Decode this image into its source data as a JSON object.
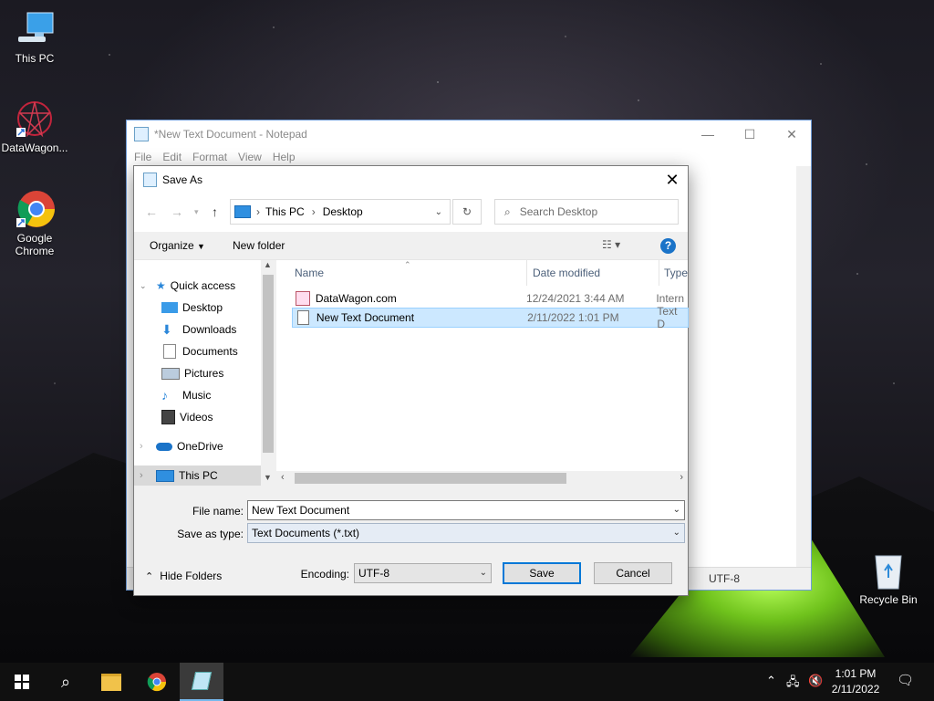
{
  "desktop": {
    "icons": [
      {
        "label": "This PC"
      },
      {
        "label": "DataWagon..."
      },
      {
        "label": "Google Chrome"
      },
      {
        "label": "Recycle Bin"
      }
    ]
  },
  "notepad": {
    "title": "*New Text Document - Notepad",
    "menu": [
      "File",
      "Edit",
      "Format",
      "View",
      "Help"
    ],
    "status_encoding": "UTF-8"
  },
  "dialog": {
    "title": "Save As",
    "address": {
      "segments": [
        "This PC",
        "Desktop"
      ]
    },
    "search_placeholder": "Search Desktop",
    "toolbar": {
      "organize": "Organize",
      "new_folder": "New folder"
    },
    "nav_items": [
      {
        "label": "Quick access",
        "icon": "star-icon"
      },
      {
        "label": "Desktop",
        "icon": "desktop-folder-icon",
        "pinned": true
      },
      {
        "label": "Downloads",
        "icon": "download-arrow-icon",
        "pinned": true
      },
      {
        "label": "Documents",
        "icon": "documents-icon",
        "pinned": true
      },
      {
        "label": "Pictures",
        "icon": "pictures-icon",
        "pinned": true
      },
      {
        "label": "Music",
        "icon": "music-note-icon"
      },
      {
        "label": "Videos",
        "icon": "film-icon"
      },
      {
        "label": "OneDrive",
        "icon": "cloud-icon"
      },
      {
        "label": "This PC",
        "icon": "monitor-icon"
      }
    ],
    "columns": [
      "Name",
      "Date modified",
      "Type"
    ],
    "files": [
      {
        "name": "DataWagon.com",
        "date": "12/24/2021 3:44 AM",
        "type": "Intern",
        "icon": "internet-shortcut-icon",
        "selected": false
      },
      {
        "name": "New Text Document",
        "date": "2/11/2022 1:01 PM",
        "type": "Text D",
        "icon": "text-file-icon",
        "selected": true
      }
    ],
    "file_name_label": "File name:",
    "file_name_value": "New Text Document",
    "save_type_label": "Save as type:",
    "save_type_value": "Text Documents (*.txt)",
    "hide_folders": "Hide Folders",
    "encoding_label": "Encoding:",
    "encoding_value": "UTF-8",
    "save_button": "Save",
    "cancel_button": "Cancel"
  },
  "taskbar": {
    "time": "1:01 PM",
    "date": "2/11/2022"
  },
  "colors": {
    "accent": "#0078d7",
    "selection": "#cce8ff",
    "taskbar": "#101010"
  }
}
